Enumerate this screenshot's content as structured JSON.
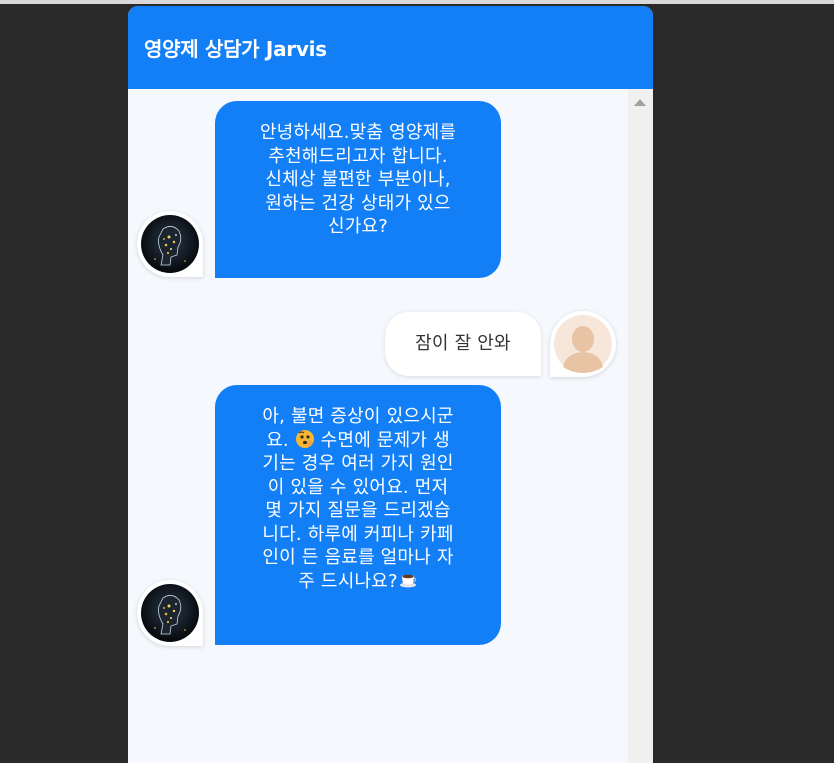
{
  "header": {
    "title": "영양제 상담가 Jarvis",
    "color": "#127ff7"
  },
  "messages": [
    {
      "sender": "bot",
      "avatar_icon": "ai-head-icon",
      "lines": [
        "안녕하세요.맞춤 영양제를",
        "추천해드리고자 합니다.",
        "신체상 불편한 부분이나,",
        "원하는 건강 상태가 있으",
        "신가요?"
      ]
    },
    {
      "sender": "user",
      "avatar_icon": "user-silhouette-icon",
      "text": "잠이 잘 안와"
    },
    {
      "sender": "bot",
      "avatar_icon": "ai-head-icon",
      "lines": [
        "아, 불면 증상이 있으시군",
        "요. ",
        " 수면에 문제가 생",
        "기는 경우 여러 가지 원인",
        "이 있을 수 있어요. 먼저",
        "몇 가지 질문을 드리겠습",
        "니다. 하루에 커피나 카페",
        "인이 든 음료를 얼마나 자",
        "주 드시나요?"
      ],
      "emojis": [
        "thinking-face-icon",
        "coffee-cup-icon"
      ]
    }
  ]
}
